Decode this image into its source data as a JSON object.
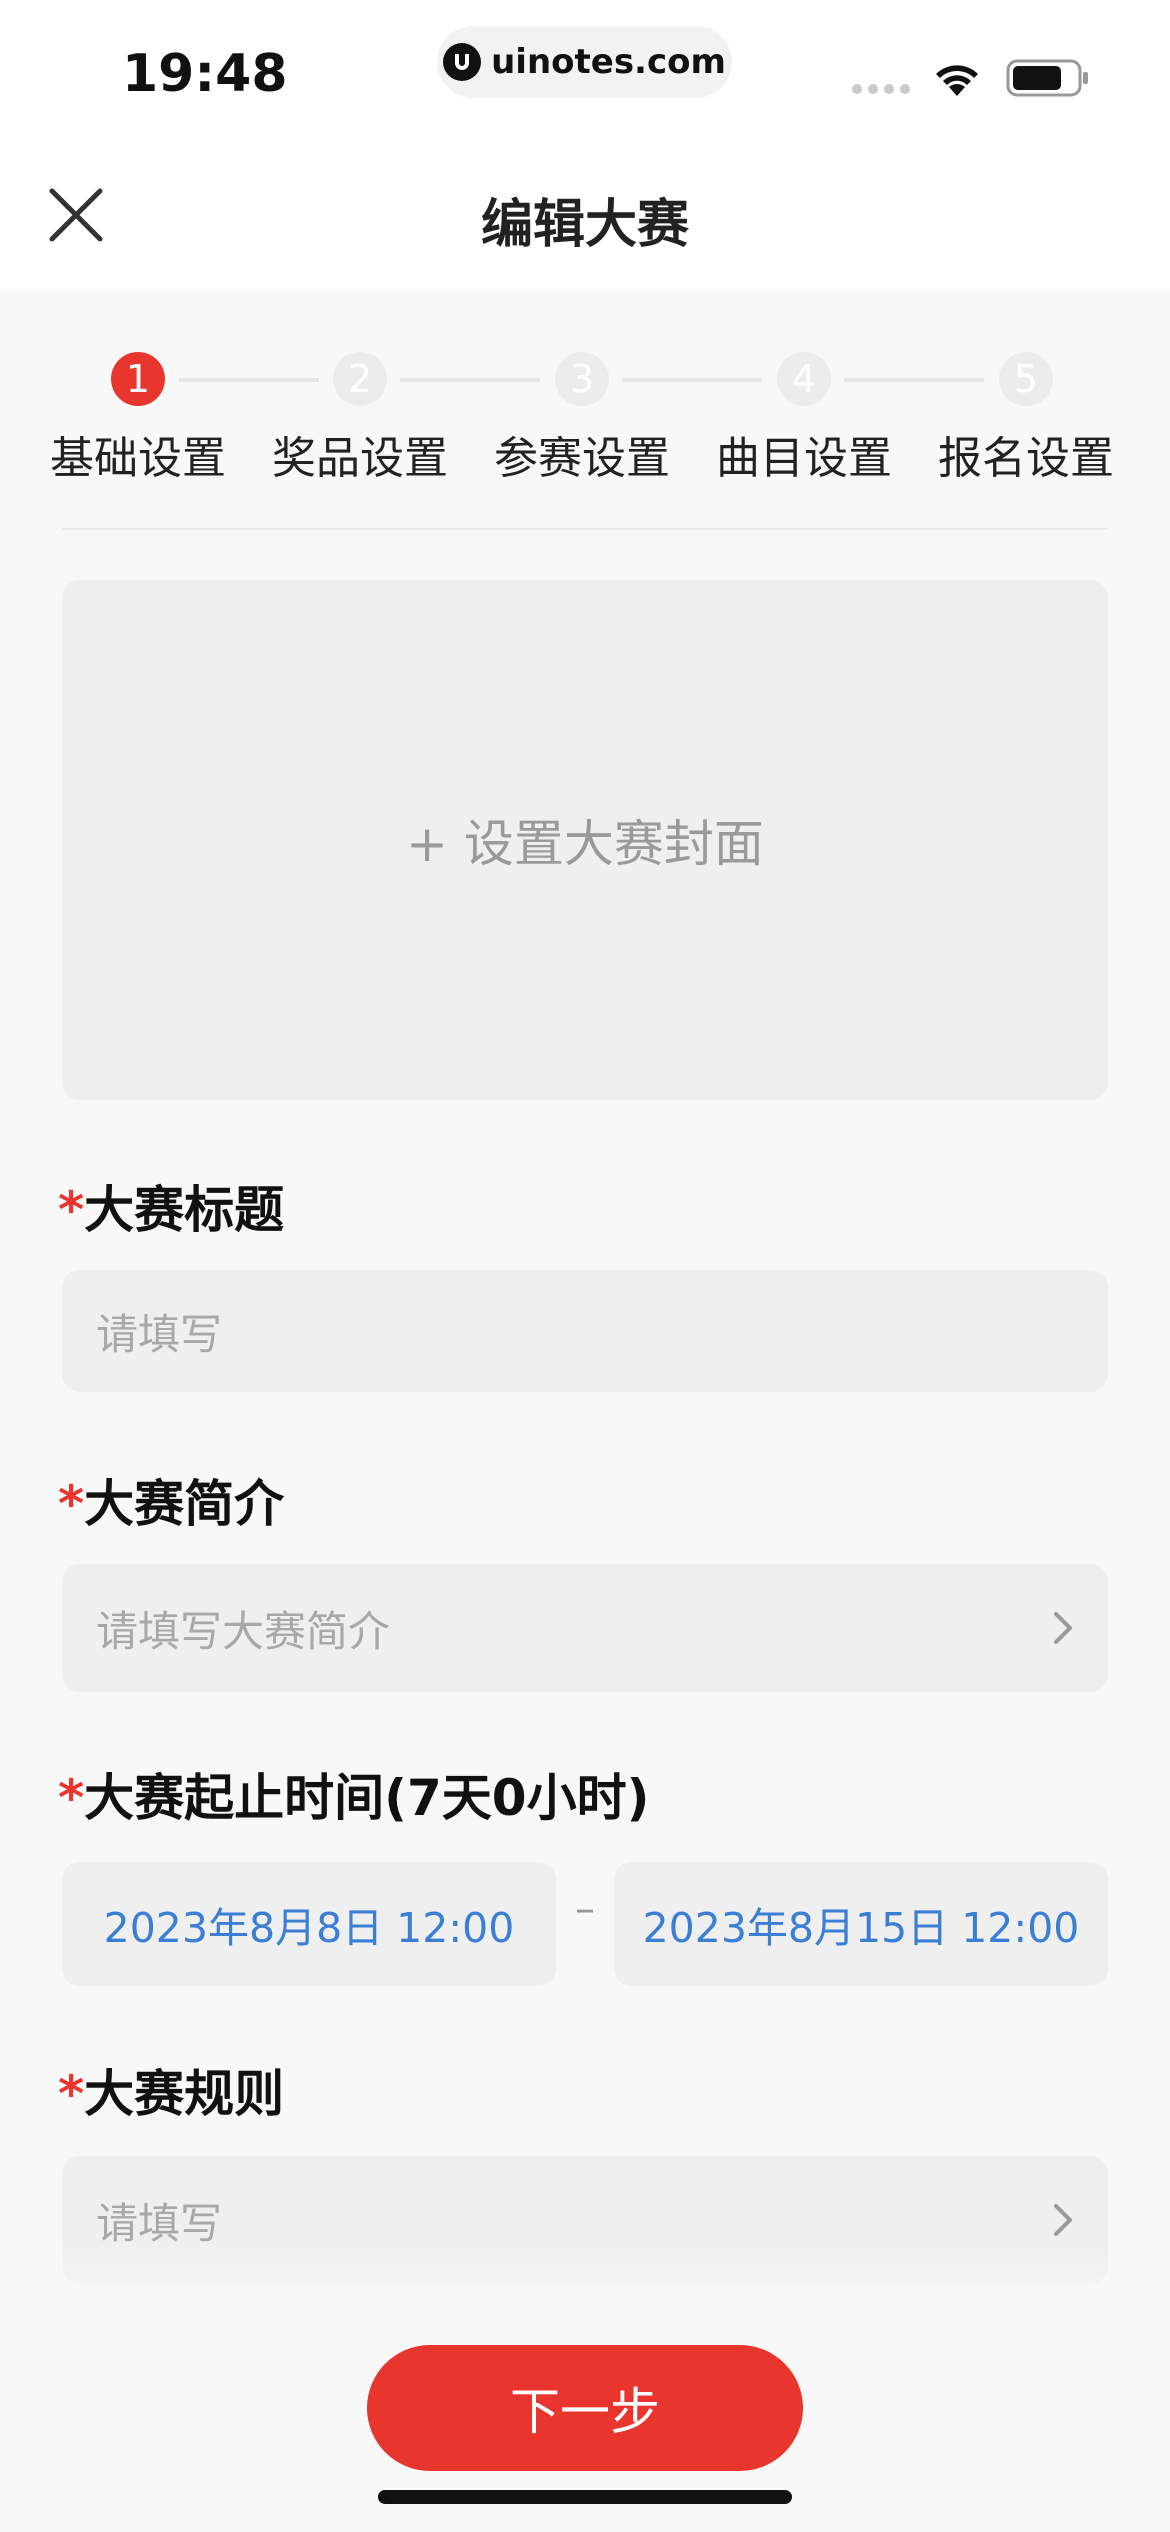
{
  "status_bar": {
    "time": "19:48",
    "url": "uinotes.com"
  },
  "header": {
    "title": "编辑大赛"
  },
  "steps": [
    {
      "number": "1",
      "label": "基础设置",
      "active": true
    },
    {
      "number": "2",
      "label": "奖品设置",
      "active": false
    },
    {
      "number": "3",
      "label": "参赛设置",
      "active": false
    },
    {
      "number": "4",
      "label": "曲目设置",
      "active": false
    },
    {
      "number": "5",
      "label": "报名设置",
      "active": false
    }
  ],
  "cover": {
    "label": "+ 设置大赛封面"
  },
  "form": {
    "required_mark": "*",
    "title_label": "大赛标题",
    "title_placeholder": "请填写",
    "intro_label": "大赛简介",
    "intro_placeholder": "请填写大赛简介",
    "time_label": "大赛起止时间(7天0小时)",
    "start_date": "2023年8月8日 12:00",
    "date_separator": "–",
    "end_date": "2023年8月15日 12:00",
    "rules_label": "大赛规则",
    "rules_placeholder": "请填写"
  },
  "footer": {
    "next_label": "下一步"
  },
  "colors": {
    "accent": "#e8362f",
    "date_text": "#3a7fd5",
    "field_bg": "#efefef"
  }
}
